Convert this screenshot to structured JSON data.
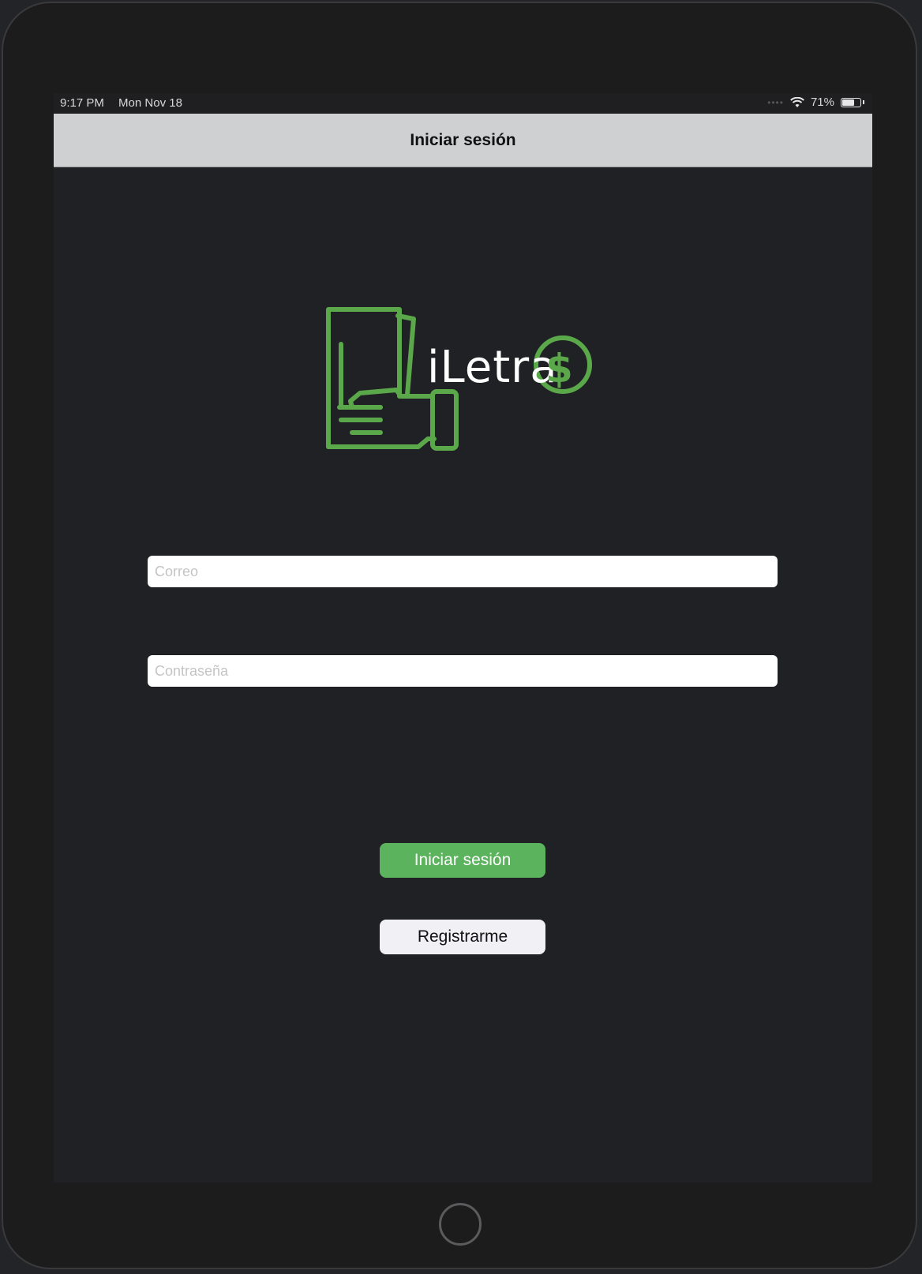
{
  "status_bar": {
    "time": "9:17 PM",
    "date": "Mon Nov 18",
    "battery_percent": "71%",
    "battery_level": 0.71
  },
  "nav": {
    "title": "Iniciar sesión"
  },
  "logo": {
    "text": "iLetras",
    "brand_color": "#5aa84a"
  },
  "form": {
    "email_placeholder": "Correo",
    "password_placeholder": "Contraseña"
  },
  "buttons": {
    "login_label": "Iniciar sesión",
    "register_label": "Registrarme"
  },
  "colors": {
    "accent": "#5cb35d",
    "screen_bg": "#202125",
    "nav_bg": "#cfd0d2"
  }
}
